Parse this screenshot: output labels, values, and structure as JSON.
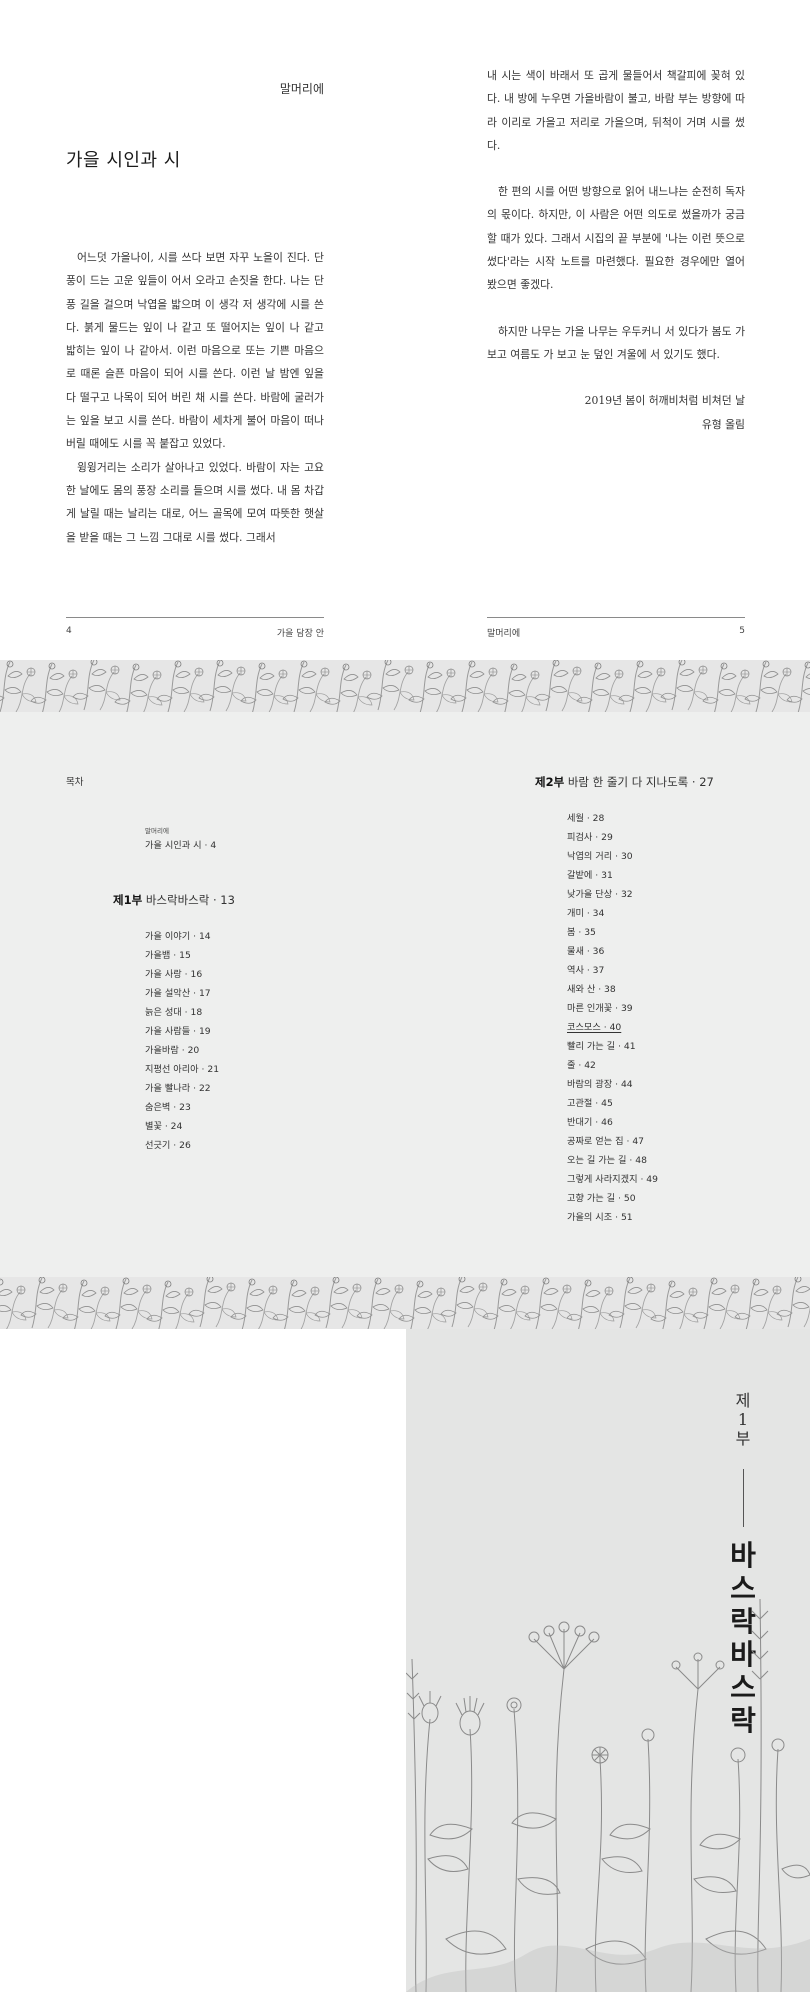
{
  "preface": {
    "running_head": "말머리에",
    "title": "가을 시인과 시",
    "left_paragraphs": [
      "어느덧 가을나이, 시를 쓰다 보면 자꾸 노을이 진다. 단풍이 드는 고운 잎들이 어서 오라고 손짓을 한다. 나는 단풍 길을 걸으며 낙엽을 밟으며 이 생각 저 생각에 시를 쓴다. 붉게 물드는 잎이 나 같고 또 떨어지는 잎이 나 같고 밟히는 잎이 나 같아서. 이런 마음으로 또는 기쁜 마음으로 때론 슬픈 마음이 되어 시를 쓴다. 이런 날 밤엔 잎을 다 떨구고 나목이 되어 버린 채 시를 쓴다. 바람에 굴러가는 잎을 보고 시를 쓴다. 바람이 세차게 불어 마음이 떠나 버릴 때에도 시를 꼭 붙잡고 있었다.",
      "윙윙거리는 소리가 살아나고 있었다. 바람이 자는 고요한 날에도 몸의 풍장 소리를 들으며 시를 썼다. 내 몸 차갑게 날릴 때는 날리는 대로, 어느 골목에 모여 따뜻한 햇살을 받을 때는 그 느낌 그대로 시를 썼다. 그래서"
    ],
    "right_paragraphs": [
      "내 시는 색이 바래서 또 곱게 물들어서 책갈피에 꽂혀 있다. 내 방에 누우면 가을바람이 불고, 바람 부는 방향에 따라 이리로 가을고 저리로 가을으며, 뒤척이 거며 시를 썼다.",
      "한 편의 시를 어떤 방향으로 읽어 내느냐는 순전히 독자의 몫이다. 하지만, 이 사람은 어떤 의도로 썼을까가 궁금할 때가 있다. 그래서 시집의 끝 부분에 '나는 이런 뜻으로 썼다'라는 시작 노트를 마련했다. 필요한 경우에만 열어 봤으면 좋겠다.",
      "하지만 나무는 가을 나무는 우두커니 서 있다가 봄도 가 보고 여름도 가 보고 눈 덮인 겨울에 서 있기도 했다."
    ],
    "signature_date": "2019년 봄이 허깨비처럼 비쳐던 날",
    "signature_name": "유형 올림",
    "left_folio_number": "4",
    "left_folio_title": "가을 담장 안",
    "right_folio_title": "말머리에",
    "right_folio_number": "5"
  },
  "toc": {
    "label": "목차",
    "preface_small": "말머리에",
    "preface_entry": "가을 시인과 시 · 4",
    "part1": {
      "bold": "제1부",
      "rest": " 바스락바스락 · 13"
    },
    "part1_items": [
      "가을 이야기 · 14",
      "가을뱀 · 15",
      "가을 사랑 · 16",
      "가을 설악산 · 17",
      "늙은 성대 · 18",
      "가을 사람들 · 19",
      "가을바람 · 20",
      "지평선 아리아 · 21",
      "가을 빨나라 · 22",
      "숨은벽 · 23",
      "별꽃 · 24",
      "선긋기 · 26"
    ],
    "part2": {
      "bold": "제2부",
      "rest": " 바람 한 줄기 다 지나도록 · 27"
    },
    "part2_items": [
      "세월 · 28",
      "피검사 · 29",
      "낙엽의 거리 · 30",
      "갈밭에 · 31",
      "낮가을 단상 · 32",
      "개미 · 34",
      "봄 · 35",
      "물새 · 36",
      "역사 · 37",
      "새와 산 · 38",
      "마른 인개꽃 · 39",
      "코스모스 · 40",
      "빨리 가는 길 · 41",
      "줄 · 42",
      "바람의 광장 · 44",
      "고관절 · 45",
      "반대기 · 46",
      "공짜로 얻는 집 · 47",
      "오는 길 가는 길 · 48",
      "그렇게 사라지겠지 · 49",
      "고향 가는 길 · 50",
      "가을의 시조 · 51"
    ]
  },
  "divider": {
    "part_chars": [
      "제",
      "1",
      "부"
    ],
    "title_chars": [
      "바",
      "스",
      "락",
      "바",
      "스",
      "락"
    ]
  },
  "colors": {
    "toc_bg": "#eeefee",
    "band_bg": "#e6e6e6",
    "divider_bg": "#e4e5e4",
    "ink": "#2a2a2a"
  }
}
